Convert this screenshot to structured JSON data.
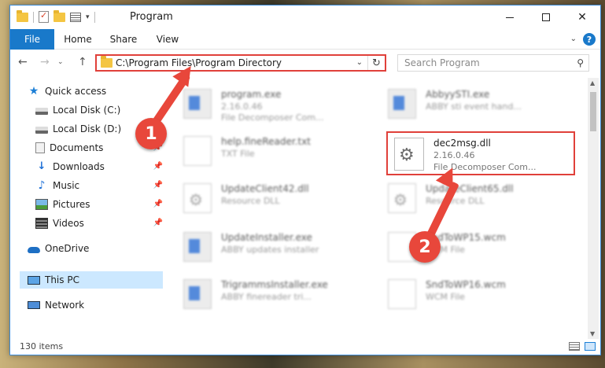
{
  "titlebar": {
    "title": "Program",
    "qat_dropdown_glyph": "▾",
    "close_glyph": "✕"
  },
  "ribbon": {
    "tabs": [
      {
        "label": "File"
      },
      {
        "label": "Home"
      },
      {
        "label": "Share"
      },
      {
        "label": "View"
      }
    ],
    "expand_glyph": "⌄",
    "help_glyph": "?"
  },
  "addressbar": {
    "back_glyph": "←",
    "forward_glyph": "→",
    "recent_glyph": "⌄",
    "up_glyph": "↑",
    "path": "C:\\Program Files\\Program Directory",
    "dropdown_glyph": "⌄",
    "refresh_glyph": "↻"
  },
  "search": {
    "placeholder": "Search Program",
    "icon_glyph": "⚲"
  },
  "navpane": {
    "items": [
      {
        "label": "Quick access",
        "icon": "star-icon",
        "pinned": false
      },
      {
        "label": "Local Disk (C:)",
        "icon": "disk-icon",
        "pinned": false
      },
      {
        "label": "Local Disk (D:)",
        "icon": "disk-icon",
        "pinned": false
      },
      {
        "label": "Documents",
        "icon": "documents-icon",
        "pinned": true
      },
      {
        "label": "Downloads",
        "icon": "download-icon",
        "pinned": true
      },
      {
        "label": "Music",
        "icon": "music-icon",
        "pinned": true
      },
      {
        "label": "Pictures",
        "icon": "pictures-icon",
        "pinned": true
      },
      {
        "label": "Videos",
        "icon": "videos-icon",
        "pinned": true
      },
      {
        "label": "OneDrive",
        "icon": "cloud-icon",
        "pinned": false
      },
      {
        "label": "This PC",
        "icon": "pc-icon",
        "pinned": false,
        "selected": true
      },
      {
        "label": "Network",
        "icon": "network-icon",
        "pinned": false
      }
    ],
    "pin_glyph": "📌",
    "star_glyph": "★",
    "download_glyph": "↓",
    "music_glyph": "♪"
  },
  "files": [
    {
      "name": "program.exe",
      "line2": "2.16.0.46",
      "line3": "File Decomposer Com...",
      "icon": "exe-icon"
    },
    {
      "name": "AbbyySTI.exe",
      "line2": "ABBY sti event hand...",
      "line3": "",
      "icon": "exe-icon"
    },
    {
      "name": "help.fineReader.txt",
      "line2": "TXT File",
      "line3": "",
      "icon": "document-icon"
    },
    {
      "name": "dec2msg.dll",
      "line2": "2.16.0.46",
      "line3": "File Decomposer Com...",
      "icon": "gear-icon",
      "highlighted": true
    },
    {
      "name": "UpdateClient42.dll",
      "line2": "Resource DLL",
      "line3": "",
      "icon": "gear-icon"
    },
    {
      "name": "UpdateClient65.dll",
      "line2": "Resource DLL",
      "line3": "",
      "icon": "gear-icon"
    },
    {
      "name": "UpdateInstaller.exe",
      "line2": "ABBY updates installer",
      "line3": "",
      "icon": "exe-icon"
    },
    {
      "name": "SndToWP15.wcm",
      "line2": "WCM File",
      "line3": "",
      "icon": "document-icon"
    },
    {
      "name": "TrigrammsInstaller.exe",
      "line2": "ABBY finereader tri...",
      "line3": "",
      "icon": "exe-icon"
    },
    {
      "name": "SndToWP16.wcm",
      "line2": "WCM File",
      "line3": "",
      "icon": "document-icon"
    }
  ],
  "scrollbar": {
    "up_glyph": "▲",
    "down_glyph": "▼"
  },
  "statusbar": {
    "item_count": "130 items"
  },
  "callouts": [
    {
      "number": "1"
    },
    {
      "number": "2"
    }
  ],
  "colors": {
    "accent": "#1979ca",
    "highlight_red": "#e0403a",
    "callout_red": "#e8473b",
    "selection": "#cce8ff"
  }
}
